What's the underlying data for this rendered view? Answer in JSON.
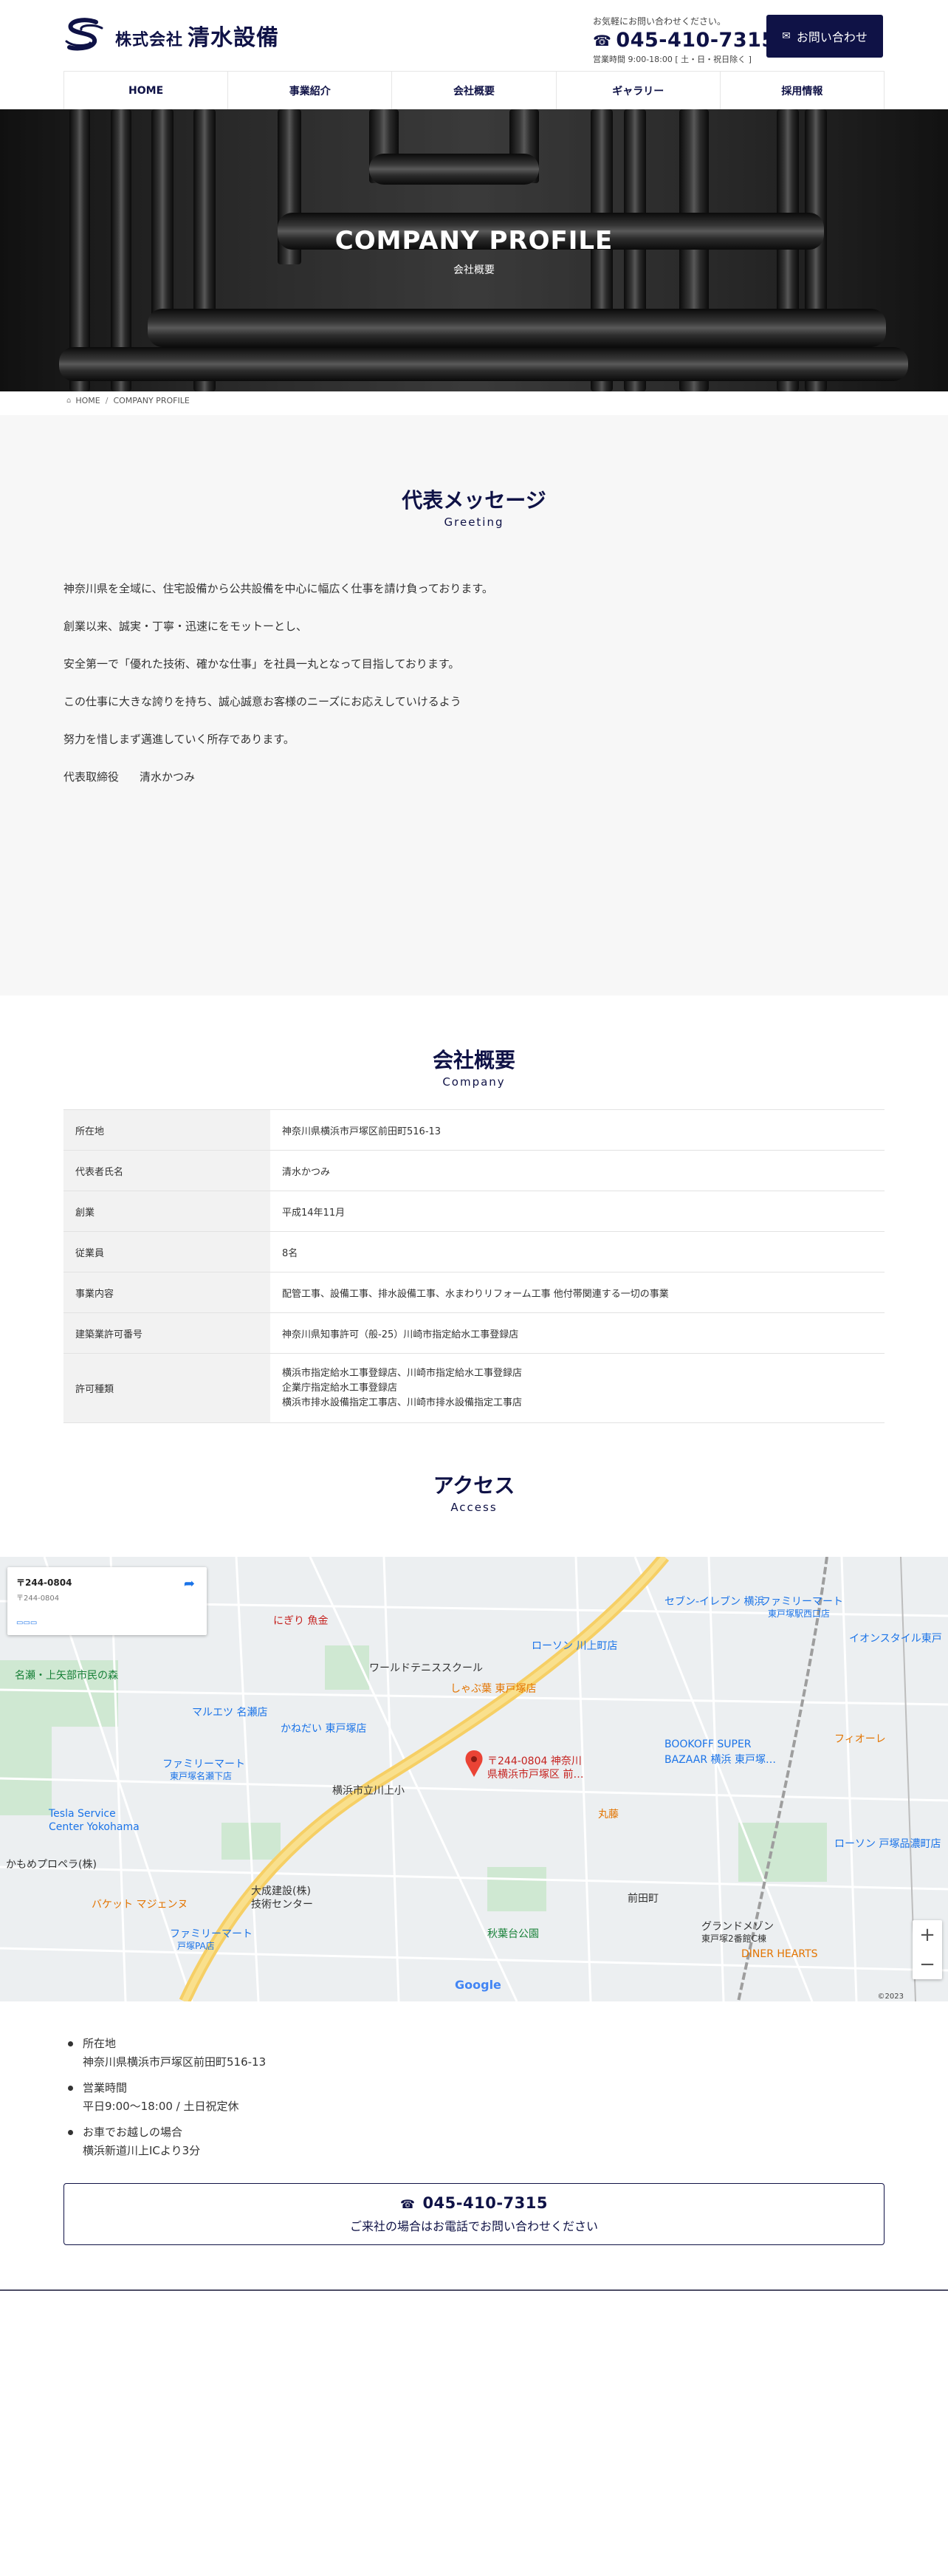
{
  "header": {
    "logo_prefix": "株式会社",
    "logo_name": "清水設備",
    "contact_note": "お気軽にお問い合わせください。",
    "phone": "045-410-7315",
    "hours": "営業時間 9:00-18:00 [ 土・日・祝日除く ]",
    "inquiry_label": "お問い合わせ"
  },
  "nav": {
    "items": [
      "HOME",
      "事業紹介",
      "会社概要",
      "ギャラリー",
      "採用情報"
    ]
  },
  "hero": {
    "title": "COMPANY PROFILE",
    "subtitle": "会社概要"
  },
  "breadcrumb": {
    "home": "HOME",
    "current": "COMPANY PROFILE"
  },
  "greeting": {
    "title": "代表メッセージ",
    "subtitle": "Greeting",
    "lines": [
      "神奈川県を全域に、住宅設備から公共設備を中心に幅広く仕事を請け負っております。",
      "創業以来、誠実・丁寧・迅速にをモットーとし、",
      "安全第一で「優れた技術、確かな仕事」を社員一丸となって目指しております。",
      "この仕事に大きな誇りを持ち、誠心誠意お客様のニーズにお応えしていけるよう",
      "努力を惜しまず邁進していく所存であります。"
    ],
    "signature_role": "代表取締役",
    "signature_name": "清水かつみ"
  },
  "company": {
    "title": "会社概要",
    "subtitle": "Company",
    "rows": [
      {
        "key": "所在地",
        "value": "神奈川県横浜市戸塚区前田町516-13"
      },
      {
        "key": "代表者氏名",
        "value": "清水かつみ"
      },
      {
        "key": "創業",
        "value": "平成14年11月"
      },
      {
        "key": "従業員",
        "value": "8名"
      },
      {
        "key": "事業内容",
        "value": "配管工事、設備工事、排水設備工事、水まわりリフォーム工事 他付帯関連する一切の事業"
      },
      {
        "key": "建築業許可番号",
        "value": "神奈川県知事許可（般-25）川崎市指定給水工事登録店"
      }
    ],
    "license_key": "許可種類",
    "license_lines": [
      "横浜市指定給水工事登録店、川崎市指定給水工事登録店",
      "企業庁指定給水工事登録店",
      " 横浜市排水設備指定工事店、川崎市排水設備指定工事店"
    ]
  },
  "access": {
    "title": "アクセス",
    "subtitle": "Access",
    "map": {
      "card_address": "〒244-0804",
      "pin_label_1": "〒244-0804 神奈川",
      "pin_label_2": "県横浜市戸塚区 前…",
      "labels": [
        "ファミリーマート",
        "東戸塚駅西口店",
        "セブン-イレブン 横浜",
        "ローソン 川上町店",
        "イオンスタイル東戸",
        "ワールドテニススクール",
        "しゃぶ葉 東戸塚店",
        "かねだい 東戸塚店",
        "マルエツ 名瀬店",
        "名瀬・上矢部市民の森",
        "ファミリーマート",
        "東戸塚名瀬下店",
        "BOOKOFF SUPER",
        "BAZAAR 横浜 東戸塚…",
        "横浜市立川上小",
        "Tesla Service",
        "Center Yokohama",
        "かもめプロペラ(株)",
        "大成建設(株)",
        "技術センター",
        "バケット マジェンヌ",
        "ファミリーマート",
        "戸塚PA店",
        "秋葉台公園",
        "前田町",
        "グランドメゾン",
        "東戸塚2番館C棟",
        "DINER HEARTS",
        "フィオーレ",
        "丸藤",
        "ローソン 戸塚品濃町店",
        "にぎり 魚金"
      ],
      "attribution": "©2023",
      "google": "Google"
    },
    "items": [
      {
        "label": "所在地",
        "value": "神奈川県横浜市戸塚区前田町516-13"
      },
      {
        "label": "営業時間",
        "value": "平日9:00〜18:00 / 土日祝定休"
      },
      {
        "label": "お車でお越しの場合",
        "value": "横浜新道川上ICより3分"
      }
    ],
    "phone": "045-410-7315",
    "phone_caption": "ご来社の場合はお電話でお問い合わせください"
  },
  "colors": {
    "brand": "#0f1246",
    "section_bg": "#f7f7f7"
  }
}
